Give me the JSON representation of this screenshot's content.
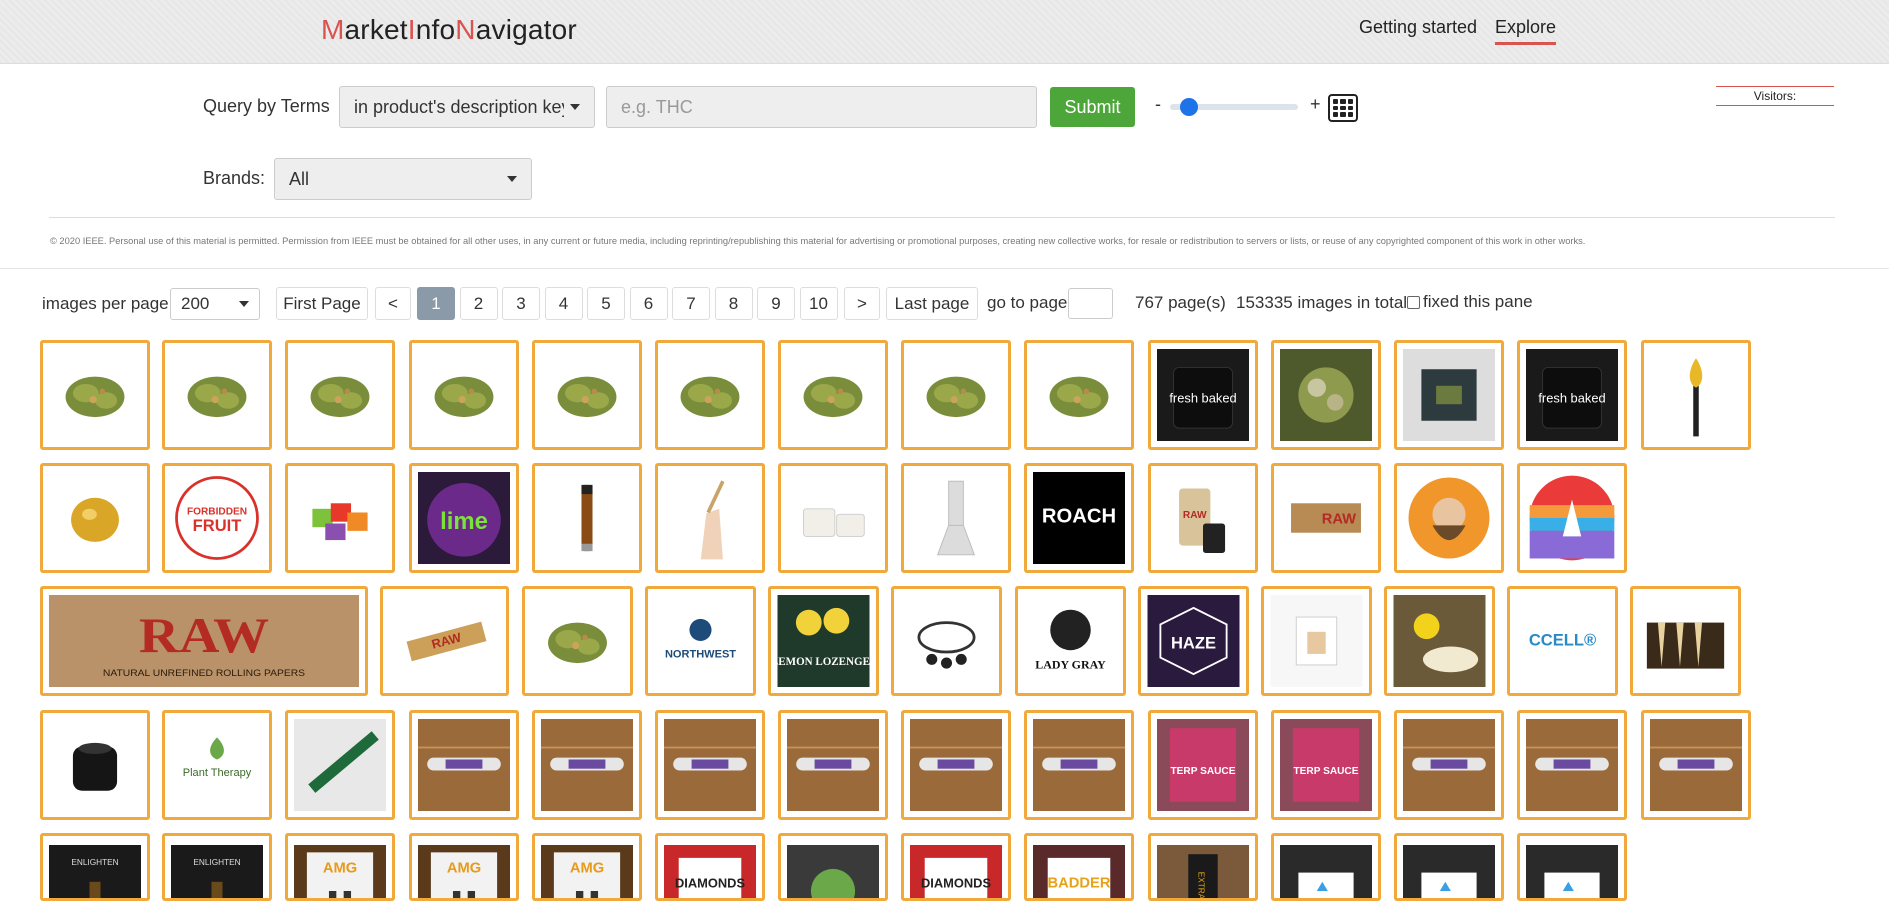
{
  "header": {
    "logo": [
      {
        "t": "M",
        "hl": true
      },
      {
        "t": "arket",
        "hl": false
      },
      {
        "t": "I",
        "hl": true
      },
      {
        "t": "nfo",
        "hl": false
      },
      {
        "t": "N",
        "hl": true
      },
      {
        "t": "avigator",
        "hl": false
      }
    ],
    "nav": {
      "getting_started": "Getting started",
      "explore": "Explore"
    }
  },
  "query": {
    "label": "Query by Terms",
    "mode_selected": "in product's description key",
    "input_placeholder": "e.g. THC",
    "input_value": "",
    "submit_label": "Submit",
    "zoom_minus": "-",
    "zoom_plus": "+",
    "zoom_level": 0.15
  },
  "visitors_label": "Visitors:",
  "brands": {
    "label": "Brands:",
    "selected": "All"
  },
  "copyright": "© 2020 IEEE. Personal use of this material is permitted. Permission from IEEE must be obtained for all other uses, in any current or future media, including reprinting/republishing this material for advertising or promotional purposes, creating new collective works, for resale or redistribution to servers or lists, or reuse of any copyrighted component of this work in other works.",
  "pagination": {
    "images_per_page_label": "images per page",
    "images_per_page_value": "200",
    "first_page": "First Page",
    "prev": "<",
    "pages": [
      "1",
      "2",
      "3",
      "4",
      "5",
      "6",
      "7",
      "8",
      "9",
      "10"
    ],
    "active_page": "1",
    "next": ">",
    "last_page": "Last page",
    "goto_label": "go to page",
    "goto_value": "",
    "pages_count": "767 page(s)",
    "total_images": "153335 images in total",
    "fixed_pane_label": "fixed this pane",
    "fixed_pane_checked": false
  },
  "colors": {
    "accent_red": "#d9534f",
    "submit_green": "#4ca63a",
    "thumb_border": "#f0a93a",
    "active_page": "#8a9aa8"
  },
  "thumbnails": [
    {
      "kind": "bud"
    },
    {
      "kind": "bud"
    },
    {
      "kind": "bud"
    },
    {
      "kind": "bud"
    },
    {
      "kind": "bud"
    },
    {
      "kind": "bud"
    },
    {
      "kind": "bud"
    },
    {
      "kind": "bud"
    },
    {
      "kind": "bud"
    },
    {
      "kind": "jar",
      "text": "fresh baked"
    },
    {
      "kind": "bud-photo"
    },
    {
      "kind": "box"
    },
    {
      "kind": "jar",
      "text": "fresh baked"
    },
    {
      "kind": "torch"
    },
    {
      "kind": "wax"
    },
    {
      "kind": "logo-ff",
      "text": "FORBIDDEN FRUIT"
    },
    {
      "kind": "gummies"
    },
    {
      "kind": "logo-lime",
      "text": "lime"
    },
    {
      "kind": "cartridge"
    },
    {
      "kind": "hand"
    },
    {
      "kind": "jars-white"
    },
    {
      "kind": "bong"
    },
    {
      "kind": "logo-roach",
      "text": "ROACH"
    },
    {
      "kind": "raw-tube",
      "text": "RAW"
    },
    {
      "kind": "raw-papers-small",
      "text": "RAW"
    },
    {
      "kind": "portrait"
    },
    {
      "kind": "palm"
    },
    {
      "kind": "raw-classic",
      "text": "RAW"
    },
    {
      "kind": "raw-pack",
      "text": "RAW"
    },
    {
      "kind": "bud"
    },
    {
      "kind": "logo-nw",
      "text": "NORTHWEST"
    },
    {
      "kind": "lozenges",
      "text": "LEMON LOZENGES"
    },
    {
      "kind": "good"
    },
    {
      "kind": "ladygray",
      "text": "LADY GRAY"
    },
    {
      "kind": "haze",
      "text": "HAZE"
    },
    {
      "kind": "card"
    },
    {
      "kind": "balm"
    },
    {
      "kind": "ccell",
      "text": "CCELL®"
    },
    {
      "kind": "cones"
    },
    {
      "kind": "device"
    },
    {
      "kind": "plant-therapy",
      "text": "Plant Therapy"
    },
    {
      "kind": "green-tube"
    },
    {
      "kind": "tube-wood"
    },
    {
      "kind": "tube-wood"
    },
    {
      "kind": "tube-wood"
    },
    {
      "kind": "tube-wood"
    },
    {
      "kind": "tube-wood"
    },
    {
      "kind": "tube-wood"
    },
    {
      "kind": "terp",
      "text": "TERP SAUCE"
    },
    {
      "kind": "terp",
      "text": "TERP SAUCE"
    },
    {
      "kind": "tube-wood"
    },
    {
      "kind": "tube-wood"
    },
    {
      "kind": "tube-wood"
    },
    {
      "kind": "enlighten",
      "text": "ENLIGHTEN"
    },
    {
      "kind": "enlighten",
      "text": "ENLIGHTEN"
    },
    {
      "kind": "amg",
      "text": "AMG"
    },
    {
      "kind": "amg",
      "text": "AMG"
    },
    {
      "kind": "amg",
      "text": "AMG"
    },
    {
      "kind": "diamonds",
      "text": "DIAMONDS"
    },
    {
      "kind": "jar-dark"
    },
    {
      "kind": "diamonds",
      "text": "DIAMONDS"
    },
    {
      "kind": "badder",
      "text": "BADDER"
    },
    {
      "kind": "extract",
      "text": "EXTRACT"
    },
    {
      "kind": "dark-box"
    },
    {
      "kind": "dark-box"
    },
    {
      "kind": "dark-box"
    }
  ]
}
